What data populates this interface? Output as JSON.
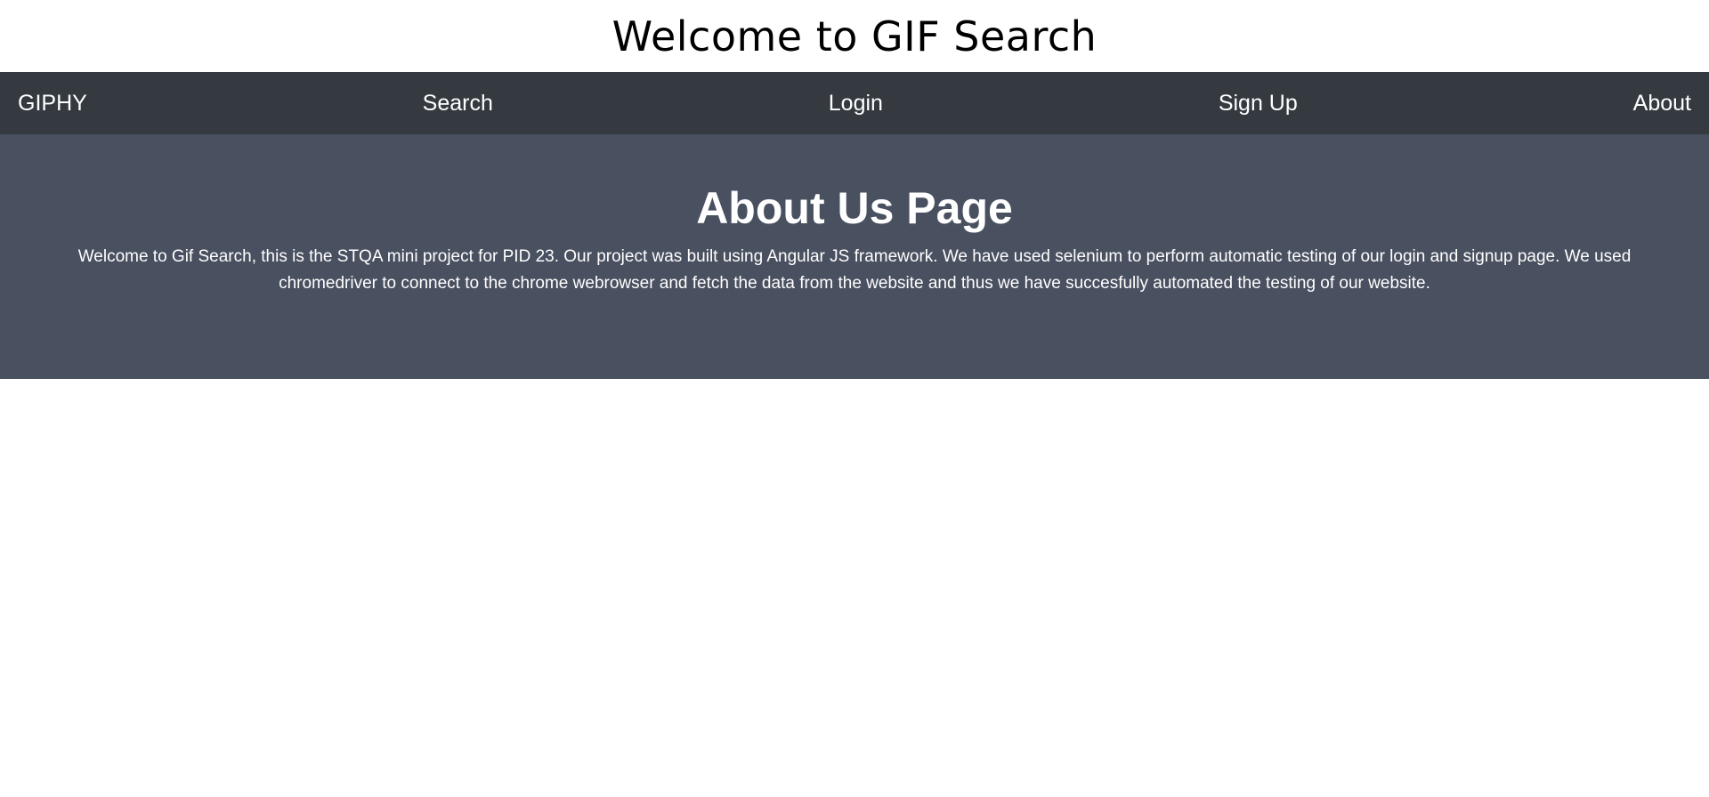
{
  "header": {
    "title": "Welcome to GIF Search"
  },
  "nav": {
    "brand": "GIPHY",
    "items": [
      {
        "label": "Search"
      },
      {
        "label": "Login"
      },
      {
        "label": "Sign Up"
      },
      {
        "label": "About"
      }
    ]
  },
  "hero": {
    "title": "About Us Page",
    "body": "Welcome to Gif Search, this is the STQA mini project for PID 23. Our project was built using Angular JS framework. We have used selenium to perform automatic testing of our login and signup page. We used chromedriver to connect to the chrome webrowser and fetch the data from the website and thus we have succesfully automated the testing of our website."
  },
  "colors": {
    "navbar_bg": "#343a40",
    "hero_bg": "#495060",
    "text_light": "#ffffff"
  }
}
